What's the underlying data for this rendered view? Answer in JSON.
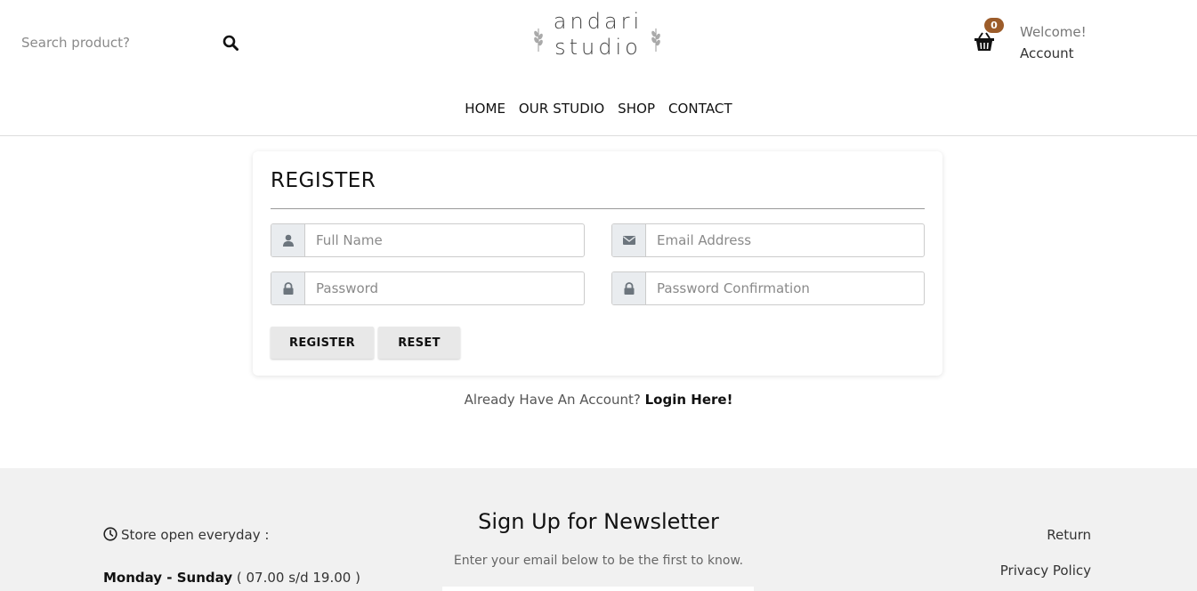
{
  "header": {
    "search": {
      "placeholder": "Search product?",
      "value": ""
    },
    "logo": {
      "line1": "andari",
      "line2": "studio"
    },
    "cart": {
      "count": "0"
    },
    "account": {
      "welcome": "Welcome!",
      "link": "Account"
    },
    "nav": [
      "HOME",
      "OUR STUDIO",
      "SHOP",
      "CONTACT"
    ]
  },
  "register": {
    "title": "REGISTER",
    "fields": {
      "full_name": {
        "placeholder": "Full Name",
        "icon": "user-icon"
      },
      "email": {
        "placeholder": "Email Address",
        "icon": "envelope-icon"
      },
      "password": {
        "placeholder": "Password",
        "icon": "lock-icon"
      },
      "password_confirmation": {
        "placeholder": "Password Confirmation",
        "icon": "lock-icon"
      }
    },
    "buttons": {
      "register": "REGISTER",
      "reset": "RESET"
    },
    "login_prompt": "Already Have An Account?",
    "login_link": "Login Here!"
  },
  "footer": {
    "hours_label": "Store open everyday :",
    "days": "Monday - Sunday",
    "hours": "( 07.00 s/d 19.00 )",
    "newsletter_title": "Sign Up for Newsletter",
    "newsletter_subtitle": "Enter your email below to be the first to know.",
    "links": [
      "Return",
      "Privacy Policy"
    ]
  },
  "colors": {
    "badge": "#9c5c2a",
    "footer_bg": "#f1f1f1",
    "addon_bg": "#e9ecef",
    "button_bg": "#e8e8e8"
  }
}
